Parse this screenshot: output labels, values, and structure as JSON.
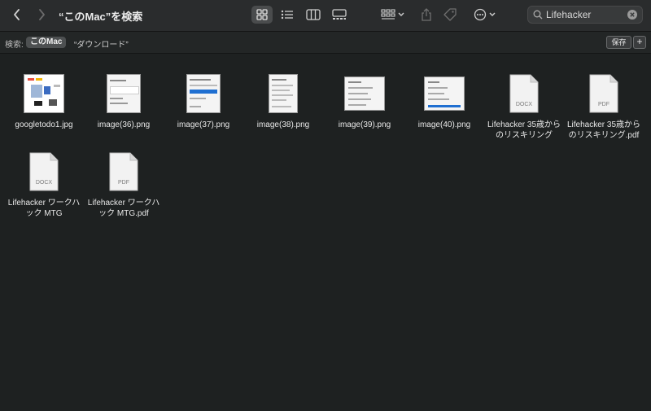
{
  "window": {
    "title": "“このMac”を検索"
  },
  "search": {
    "value": "Lifehacker",
    "placeholder": "検索"
  },
  "scope": {
    "label": "検索:",
    "active": "このMac",
    "other": "“ダウンロード”",
    "save_label": "保存",
    "add_label": "+"
  },
  "files": [
    {
      "name": "googletodo1.jpg",
      "kind": "image"
    },
    {
      "name": "image(36).png",
      "kind": "image"
    },
    {
      "name": "image(37).png",
      "kind": "image"
    },
    {
      "name": "image(38).png",
      "kind": "image"
    },
    {
      "name": "image(39).png",
      "kind": "image"
    },
    {
      "name": "image(40).png",
      "kind": "image"
    },
    {
      "name": "Lifehacker 35歳からのリスキリング",
      "kind": "document",
      "ext": "DOCX"
    },
    {
      "name": "Lifehacker 35歳からのリスキリング.pdf",
      "kind": "document",
      "ext": "PDF"
    },
    {
      "name": "Lifehacker ワークハック MTG",
      "kind": "document",
      "ext": "DOCX"
    },
    {
      "name": "Lifehacker ワークハック MTG.pdf",
      "kind": "document",
      "ext": "PDF"
    }
  ],
  "colors": {
    "background": "#1e2121",
    "toolbar": "#2a2c2d",
    "selection": "#1f6fd1"
  }
}
